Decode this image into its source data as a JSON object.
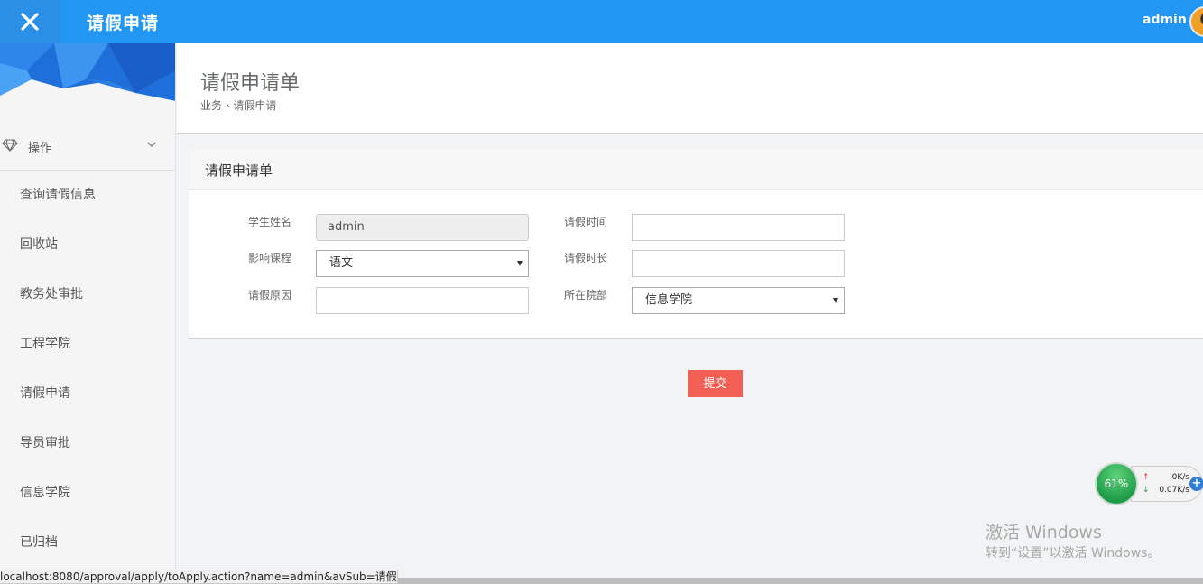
{
  "header": {
    "app_title": "请假申请",
    "user": "admin"
  },
  "sidebar": {
    "group_label": "操作",
    "items": [
      {
        "label": "查询请假信息"
      },
      {
        "label": "回收站"
      },
      {
        "label": "教务处审批"
      },
      {
        "label": "工程学院"
      },
      {
        "label": "请假申请"
      },
      {
        "label": "导员审批"
      },
      {
        "label": "信息学院"
      },
      {
        "label": "已归档"
      }
    ]
  },
  "page": {
    "title": "请假申请单",
    "breadcrumb": "业务 › 请假申请"
  },
  "form": {
    "panel_title": "请假申请单",
    "student_name_label": "学生姓名",
    "student_name_value": "admin",
    "leave_time_label": "请假时间",
    "leave_time_value": "",
    "course_label": "影响课程",
    "course_selected": "语文",
    "duration_label": "请假时长",
    "duration_value": "",
    "reason_label": "请假原因",
    "reason_value": "",
    "department_label": "所在院部",
    "department_selected": "信息学院",
    "submit_label": "提交"
  },
  "widget": {
    "percent": "61%",
    "up_speed": "0K/s",
    "down_speed": "0.07K/s"
  },
  "watermark": {
    "line1": "激活 Windows",
    "line2": "转到“设置”以激活 Windows。"
  },
  "status_bar": {
    "url": "localhost:8080/approval/apply/toApply.action?name=admin&avSub=请假"
  },
  "colors": {
    "topbar": "#2196f3",
    "submit": "#f25f54"
  }
}
